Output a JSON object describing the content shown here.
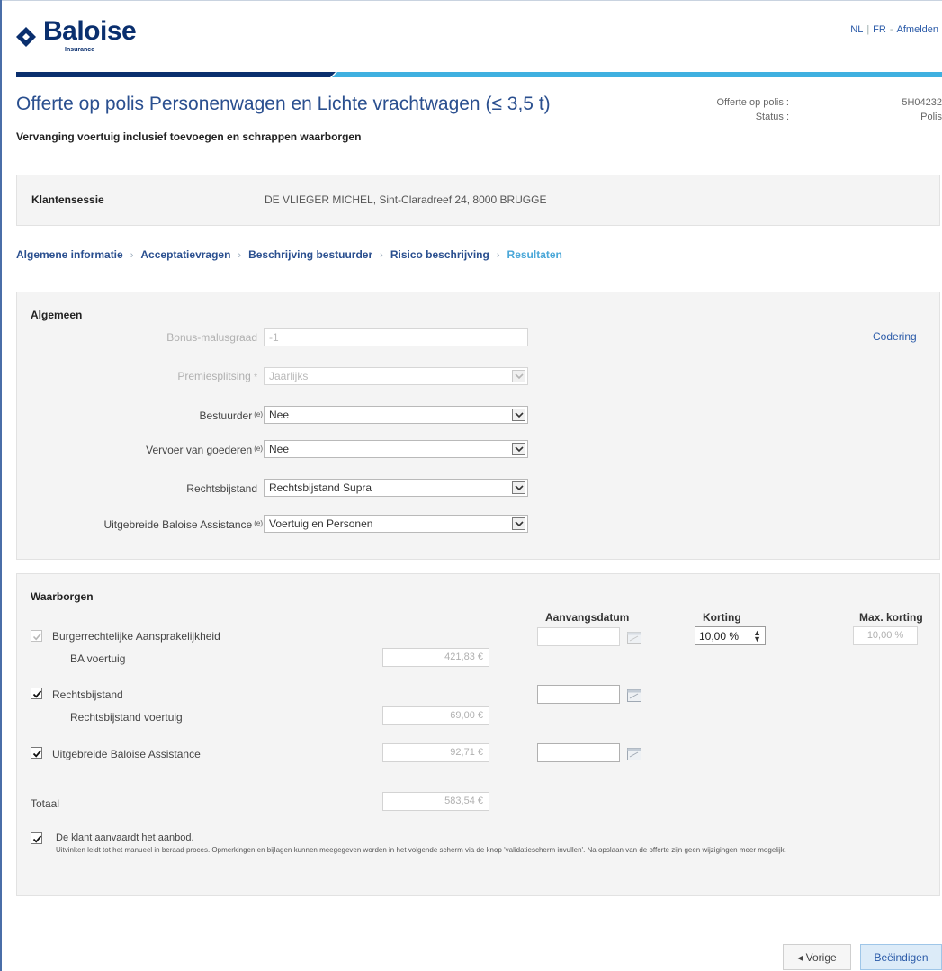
{
  "brand": {
    "name": "Baloise",
    "sub": "Insurance"
  },
  "lang": {
    "nl": "NL",
    "fr": "FR",
    "logout": "Afmelden"
  },
  "header": {
    "title": "Offerte op polis Personenwagen en Lichte vrachtwagen (≤ 3,5 t)",
    "subtitle": "Vervanging voertuig inclusief toevoegen en schrappen waarborgen",
    "meta_offer_label": "Offerte op polis :",
    "meta_status_label": "Status :",
    "meta_offer_value": "5H04232",
    "meta_status_value": "Polis"
  },
  "session": {
    "label": "Klantensessie",
    "value": "DE VLIEGER MICHEL, Sint-Claradreef 24, 8000 BRUGGE"
  },
  "breadcrumb": [
    {
      "label": "Algemene informatie"
    },
    {
      "label": "Acceptatievragen"
    },
    {
      "label": "Beschrijving bestuurder"
    },
    {
      "label": "Risico beschrijving"
    },
    {
      "label": "Resultaten"
    }
  ],
  "algemeen": {
    "title": "Algemeen",
    "codering_link": "Codering",
    "req_marker": "(e)",
    "fields": [
      {
        "label": "Bonus-malusgraad",
        "value": "-1"
      },
      {
        "label": "Premiesplitsing",
        "value": "Jaarlijks"
      },
      {
        "label": "Bestuurder",
        "value": "Nee"
      },
      {
        "label": "Vervoer van goederen",
        "value": "Nee"
      },
      {
        "label": "Rechtsbijstand",
        "value": "Rechtsbijstand Supra"
      },
      {
        "label": "Uitgebreide Baloise Assistance",
        "value": "Voertuig en Personen"
      }
    ]
  },
  "waarborgen": {
    "title": "Waarborgen",
    "col_start": "Aanvangsdatum",
    "col_korting": "Korting",
    "col_max": "Max. korting",
    "ba": {
      "label": "Burgerrechtelijke Aansprakelijkheid",
      "sub_label": "BA voertuig",
      "amount": "421,83 €",
      "korting": "10,00 %",
      "max_korting": "10,00 %"
    },
    "rb": {
      "label": "Rechtsbijstand",
      "sub_label": "Rechtsbijstand voertuig",
      "amount": "69,00 €"
    },
    "uba": {
      "label": "Uitgebreide Baloise Assistance",
      "amount": "92,71 €"
    },
    "total_label": "Totaal",
    "total_amount": "583,54 €",
    "accept_label": "De klant aanvaardt het aanbod.",
    "note": "Uitvinken leidt tot het manueel in beraad proces. Opmerkingen en bijlagen kunnen meegegeven worden in het volgende scherm via de knop 'validatiescherm invullen'. Na opslaan van de offerte zijn geen wijzigingen meer mogelijk."
  },
  "buttons": {
    "prev": "◂  Vorige",
    "finish": "Beëindigen"
  },
  "colors": {
    "brand": "#0a2f6e",
    "accent": "#4aa7d8",
    "link": "#2a5aa8"
  }
}
